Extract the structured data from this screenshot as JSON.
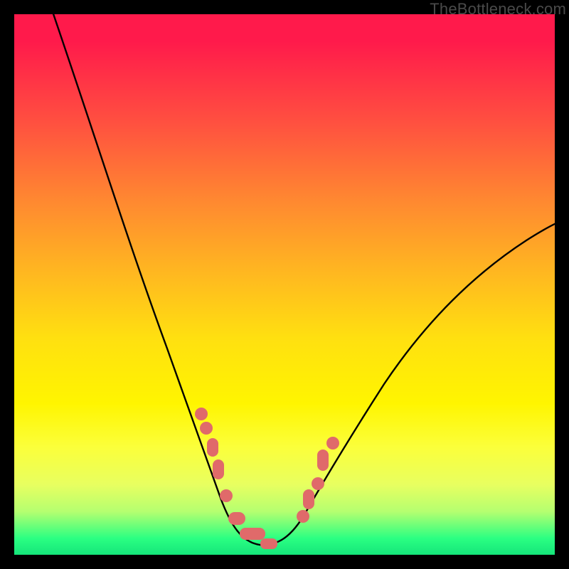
{
  "watermark": "TheBottleneck.com",
  "colors": {
    "markers": "#e06a6a",
    "curve": "#000000",
    "background_black": "#000000"
  },
  "chart_data": {
    "type": "line",
    "title": "",
    "xlabel": "",
    "ylabel": "",
    "x": [
      0.0,
      0.05,
      0.1,
      0.15,
      0.2,
      0.25,
      0.3,
      0.35,
      0.375,
      0.4,
      0.425,
      0.45,
      0.475,
      0.5,
      0.55,
      0.6,
      0.65,
      0.7,
      0.75,
      0.8,
      0.85,
      0.9,
      0.95,
      1.0
    ],
    "values": [
      1.02,
      0.94,
      0.86,
      0.78,
      0.69,
      0.58,
      0.44,
      0.27,
      0.17,
      0.08,
      0.02,
      0.0,
      0.0,
      0.02,
      0.1,
      0.21,
      0.3,
      0.38,
      0.45,
      0.51,
      0.56,
      0.6,
      0.63,
      0.65
    ],
    "ylim": [
      0,
      1.02
    ],
    "xlim": [
      0,
      1
    ],
    "markers_left": [
      {
        "x": 0.348,
        "y": 0.255
      },
      {
        "x": 0.36,
        "y": 0.23
      },
      {
        "x": 0.367,
        "y": 0.202
      },
      {
        "x": 0.372,
        "y": 0.155
      },
      {
        "x": 0.392,
        "y": 0.102
      }
    ],
    "markers_bottom": [
      {
        "x": 0.41,
        "y": 0.05
      },
      {
        "x": 0.425,
        "y": 0.025
      },
      {
        "x": 0.47,
        "y": 0.01
      }
    ],
    "markers_right": [
      {
        "x": 0.535,
        "y": 0.06
      },
      {
        "x": 0.545,
        "y": 0.09
      },
      {
        "x": 0.56,
        "y": 0.116
      },
      {
        "x": 0.572,
        "y": 0.17
      },
      {
        "x": 0.59,
        "y": 0.2
      }
    ]
  }
}
